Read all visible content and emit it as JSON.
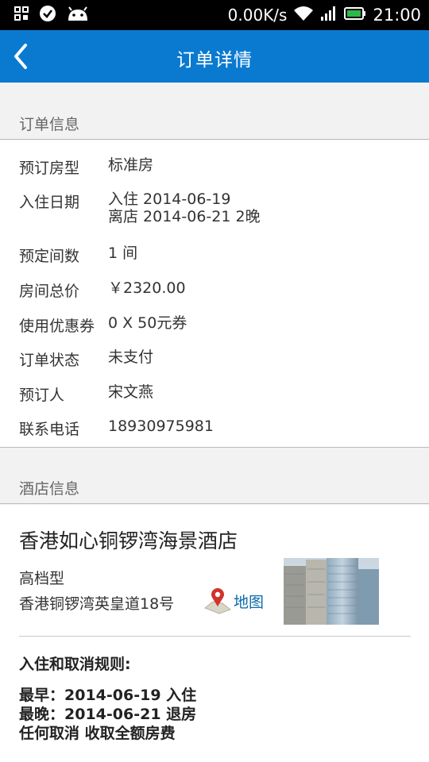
{
  "status_bar": {
    "net_speed": "0.00K/s",
    "time": "21:00",
    "icons": [
      "grid-icon",
      "check-circle-icon",
      "android-icon",
      "wifi-icon",
      "signal-icon",
      "battery-icon"
    ]
  },
  "app_bar": {
    "title": "订单详情",
    "back_icon": "chevron-left-icon"
  },
  "order_info": {
    "section_title": "订单信息",
    "room_type": {
      "label": "预订房型",
      "value": "标准房"
    },
    "stay_dates": {
      "label": "入住日期",
      "checkin": "入住 2014-06-19",
      "checkout": "离店 2014-06-21 2晚"
    },
    "rooms": {
      "label": "预定间数",
      "value": "1 间"
    },
    "total_price": {
      "label": "房间总价",
      "value": "￥2320.00"
    },
    "coupon": {
      "label": "使用优惠券",
      "value": "0 X 50元券"
    },
    "status": {
      "label": "订单状态",
      "value": "未支付"
    },
    "booker": {
      "label": "预订人",
      "value": "宋文燕"
    },
    "phone": {
      "label": "联系电话",
      "value": "18930975981"
    }
  },
  "hotel_info": {
    "section_title": "酒店信息",
    "name": "香港如心铜锣湾海景酒店",
    "grade": "高档型",
    "address": "香港铜锣湾英皇道18号",
    "map_label": "地图",
    "rules_title": "入住和取消规则:",
    "rules": [
      "最早：2014-06-19 入住",
      "最晚：2014-06-21 退房",
      "任何取消 收取全额房费"
    ]
  },
  "colors": {
    "accent": "#0a7ad0",
    "link": "#0a6aa8",
    "status_bar": "#000000",
    "battery": "#2fb84a"
  }
}
